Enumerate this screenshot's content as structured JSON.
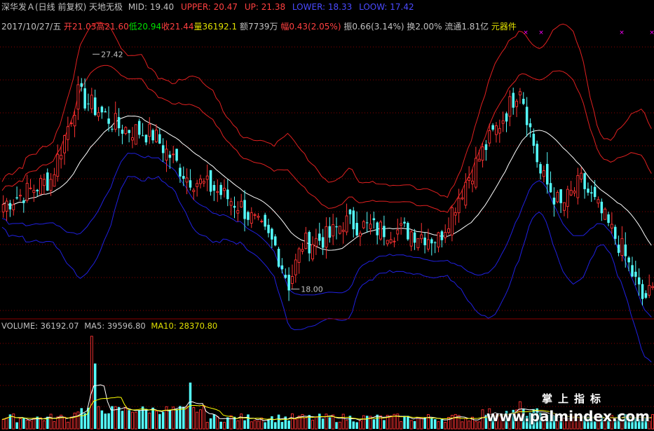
{
  "header": {
    "title": "深华发Ａ(日线 前复权) 天地无极",
    "mid_label": "MID: 19.40",
    "upper_label": "UPPER: 20.47",
    "up_label": "UP: 21.38",
    "lower_label": "LOWER: 18.33",
    "loow_label": "LOOW: 17.42"
  },
  "quote": {
    "date": "2017/10/27/五",
    "open": "开21.03",
    "high": "高21.60",
    "low": "低20.94",
    "close": "收21.44",
    "volume": "量36192.1",
    "amount": "额7739万",
    "change": "幅0.43(2.05%)",
    "amplitude": "振0.66(3.14%)",
    "turnover": "换2.00%",
    "float_cap": "流通1.81亿",
    "sector": "元器件"
  },
  "volume_header": {
    "volume": "VOLUME: 36192.07",
    "ma5": "MA5: 39596.80",
    "ma10": "MA10: 28370.80"
  },
  "watermark": {
    "cn": "掌上指标",
    "url": "www.palmindex.com"
  },
  "colors": {
    "up": "#ff3232",
    "down": "#54fcfc",
    "mid_line": "#ffffff",
    "upper_band": "#e02020",
    "lower_band": "#2020e0",
    "ma10": "#ffff00",
    "grid": "#8a0000",
    "text_white": "#c0c0c0",
    "text_red": "#ff4040",
    "text_green": "#00e000",
    "text_blue": "#4a4aff",
    "text_yellow": "#e0e000"
  },
  "chart_data": [
    {
      "type": "candlestick",
      "y_axis_range": [
        17.0,
        28.3
      ],
      "annotations": [
        {
          "text": "27.42",
          "at_price": 27.42
        },
        {
          "text": "18.00",
          "at_price": 18.0
        }
      ],
      "key_points": [
        {
          "i": 0,
          "close": 21.4
        },
        {
          "i": 14,
          "close": 22.4
        },
        {
          "i": 22,
          "close": 25.8
        },
        {
          "i": 34,
          "close": 24.5
        },
        {
          "i": 44,
          "close": 24.2
        },
        {
          "i": 54,
          "close": 22.5
        },
        {
          "i": 62,
          "close": 22.0
        },
        {
          "i": 70,
          "close": 21.3
        },
        {
          "i": 80,
          "close": 19.7
        },
        {
          "i": 84,
          "close": 18.2
        },
        {
          "i": 88,
          "close": 19.8
        },
        {
          "i": 96,
          "close": 20.1
        },
        {
          "i": 100,
          "close": 20.7
        },
        {
          "i": 110,
          "close": 20.4
        },
        {
          "i": 120,
          "close": 20.3
        },
        {
          "i": 128,
          "close": 20.0
        },
        {
          "i": 136,
          "close": 22.3
        },
        {
          "i": 144,
          "close": 24.2
        },
        {
          "i": 148,
          "close": 25.1
        },
        {
          "i": 152,
          "close": 26.2
        },
        {
          "i": 158,
          "close": 22.6
        },
        {
          "i": 164,
          "close": 21.3
        },
        {
          "i": 170,
          "close": 22.3
        },
        {
          "i": 176,
          "close": 21.0
        },
        {
          "i": 182,
          "close": 19.6
        },
        {
          "i": 188,
          "close": 17.6
        },
        {
          "i": 191,
          "close": 17.9
        }
      ],
      "bar_count": 192,
      "series": [
        {
          "name": "MID",
          "color_key": "mid_line"
        },
        {
          "name": "UPPER",
          "color_key": "upper_band"
        },
        {
          "name": "UP",
          "color_key": "upper_band"
        },
        {
          "name": "LOWER",
          "color_key": "lower_band"
        },
        {
          "name": "LOOW",
          "color_key": "lower_band"
        }
      ]
    },
    {
      "type": "bar",
      "y_axis_range": [
        0,
        180000
      ],
      "series": [
        {
          "name": "VOLUME",
          "color_key": "down"
        },
        {
          "name": "MA5",
          "color_key": "mid_line"
        },
        {
          "name": "MA10",
          "color_key": "ma10"
        }
      ],
      "spikes": [
        {
          "i": 26,
          "value": 170000
        },
        {
          "i": 27,
          "value": 120000
        },
        {
          "i": 55,
          "value": 85000
        },
        {
          "i": 152,
          "value": 50000
        }
      ]
    }
  ]
}
